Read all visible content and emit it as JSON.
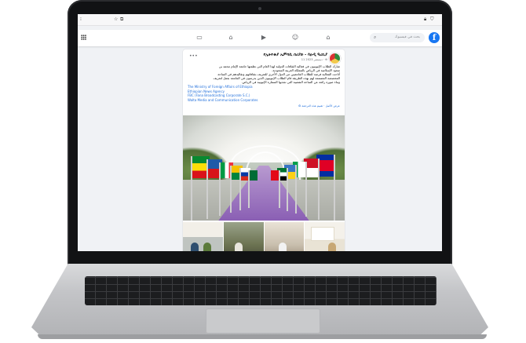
{
  "colors": {
    "facebook_blue": "#1877f2",
    "link_blue": "#216fdb",
    "carpet_purple": "#8a5fb4"
  },
  "browser": {
    "left_icons": [
      "menu-icon",
      "star-icon",
      "tabs-icon"
    ],
    "right_icons": [
      "lock-icon",
      "shield-icon"
    ]
  },
  "facebook": {
    "logo_letter": "f",
    "search_placeholder": "بحث في فيسبوك",
    "nav_icons": [
      "gaming-icon",
      "marketplace-icon",
      "watch-icon",
      "groups-icon",
      "home-icon"
    ]
  },
  "post": {
    "page_name": "የኢትዮጵያ ኤምባሲ በሪያድ - ሳዑዲ ዓረቢያ",
    "date": "11 ديسمبر 2023 · ",
    "body_lines": [
      "شارك الطلاب الإثيوبيون في فعالية الثقافات الدولية لهذا العام التي نظمتها جامعة الإمام محمد بن",
      "سعود الإسلامية في الرياض بالمملكة العربية السعودية.",
      "أتاحت الفعالية فرصة للطلاب الجامعيين من الدول الأخرى للتعريف بثقافاتهم وتقاليدهم في الساحة",
      "المخصصة المصممة لهم بهذه الطريقة قام الطلاب الإثيوبيون الذين يدرسون في الجامعة بعمل لتعريف",
      "وبناء صورة رائعة عن الساحة الشعبية التي تجذبها السفارة الإثيوبية في الرياض."
    ],
    "links": [
      "The Ministry of Foreign Affairs of Ethiopia",
      "Ethiopian News Agency",
      "FBC (Fana Broadcasting Corporate S.C.)",
      "Walta Media and Communication Corporates"
    ],
    "translate_text": "عرض الأصل · تقييم هذه الترجمة"
  }
}
